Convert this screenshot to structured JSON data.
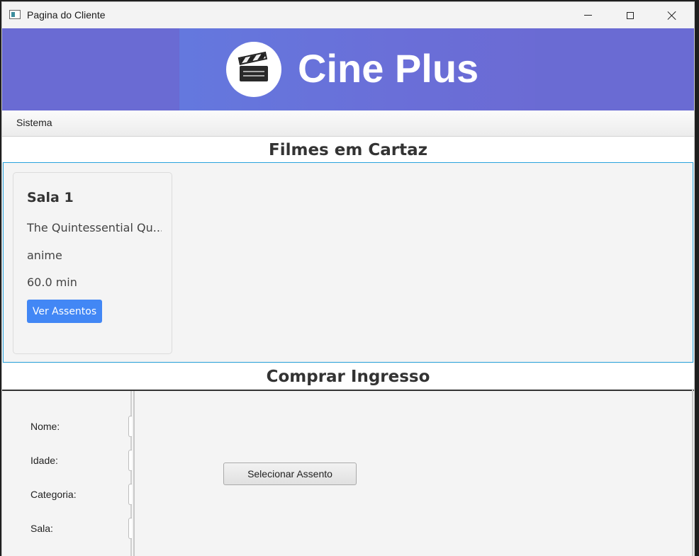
{
  "window": {
    "title": "Pagina do Cliente"
  },
  "banner": {
    "brand": "Cine Plus",
    "logo_icon": "clapperboard-icon"
  },
  "menu": {
    "items": [
      {
        "label": "Sistema"
      }
    ]
  },
  "sections": {
    "movies_header": "Filmes em Cartaz",
    "purchase_header": "Comprar Ingresso"
  },
  "movies": [
    {
      "sala": "Sala 1",
      "title": "The Quintessential Qu...",
      "genre": "anime",
      "duration": "60.0 min",
      "button_label": "Ver Assentos"
    }
  ],
  "purchase_form": {
    "fields": [
      {
        "label": "Nome:"
      },
      {
        "label": "Idade:"
      },
      {
        "label": "Categoria:"
      },
      {
        "label": "Sala:"
      }
    ],
    "select_seat_label": "Selecionar Assento"
  },
  "colors": {
    "banner_bg": "#6a6bd3",
    "accent_button": "#4287f5",
    "movies_border": "#29a3dd"
  }
}
